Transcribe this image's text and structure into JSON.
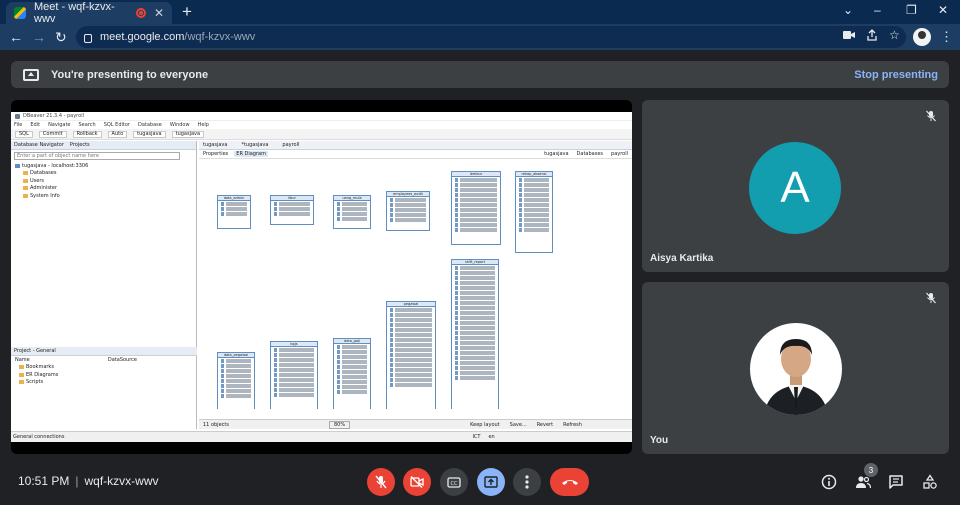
{
  "browser": {
    "tab_title": "Meet - wqf-kzvx-wwv",
    "new_tab_symbol": "+",
    "url_host": "meet.google.com",
    "url_path": "/wqf-kzvx-wwv",
    "window_controls": [
      "⌄",
      "–",
      "❐",
      "✕"
    ]
  },
  "banner": {
    "message": "You're presenting to everyone",
    "stop_label": "Stop presenting"
  },
  "shared_screen": {
    "window_title": "DBeaver 21.3.4 - payroll",
    "menu": [
      "File",
      "Edit",
      "Navigate",
      "Search",
      "SQL Editor",
      "Database",
      "Window",
      "Help"
    ],
    "toolbar": {
      "sql": "SQL",
      "commit": "Commit",
      "rollback": "Rollback",
      "auto": "Auto",
      "db1": "tugasjava",
      "db2": "tugasjava"
    },
    "left_tabs": [
      "Database Navigator",
      "Projects"
    ],
    "filter_placeholder": "Enter a part of object name here",
    "tree": [
      "tugasjava - localhost:3306",
      "Databases",
      "Users",
      "Administer",
      "System Info"
    ],
    "project_pane": {
      "title": "Project - General",
      "col_name": "Name",
      "col_source": "DataSource",
      "items": [
        "Bookmarks",
        "ER Diagrams",
        "Scripts"
      ]
    },
    "editor_tabs": [
      "tugasjava",
      "*tugasjava",
      "payroll"
    ],
    "sub_tabs": [
      "Properties",
      "ER Diagram"
    ],
    "breadcrumb": [
      "tugasjava",
      "Databases",
      "payroll"
    ],
    "entities": [
      "data_admin",
      "libur",
      "uang_mula",
      "employees_audit",
      "lembur",
      "rekap_absensi",
      "data_pegawai",
      "bpjs",
      "data_gaji",
      "pegawai",
      "shift_report"
    ],
    "status": {
      "objects": "11 objects",
      "zoom": "80%",
      "keep_layout": "Keep layout",
      "save": "Save...",
      "revert": "Revert",
      "refresh": "Refresh"
    },
    "footer": {
      "left": "General connections",
      "tz": "ICT",
      "lang": "en"
    }
  },
  "participants": [
    {
      "name": "Aisya Kartika",
      "initial": "A",
      "avatar_color": "#129eaf",
      "muted": true
    },
    {
      "name": "You",
      "muted": true
    }
  ],
  "bottom_bar": {
    "time": "10:51 PM",
    "meeting_code": "wqf-kzvx-wwv",
    "participant_count": "3"
  },
  "colors": {
    "accent_blue": "#8ab4f8",
    "danger_red": "#ea4335",
    "surface": "#3c4043",
    "background": "#202124"
  }
}
